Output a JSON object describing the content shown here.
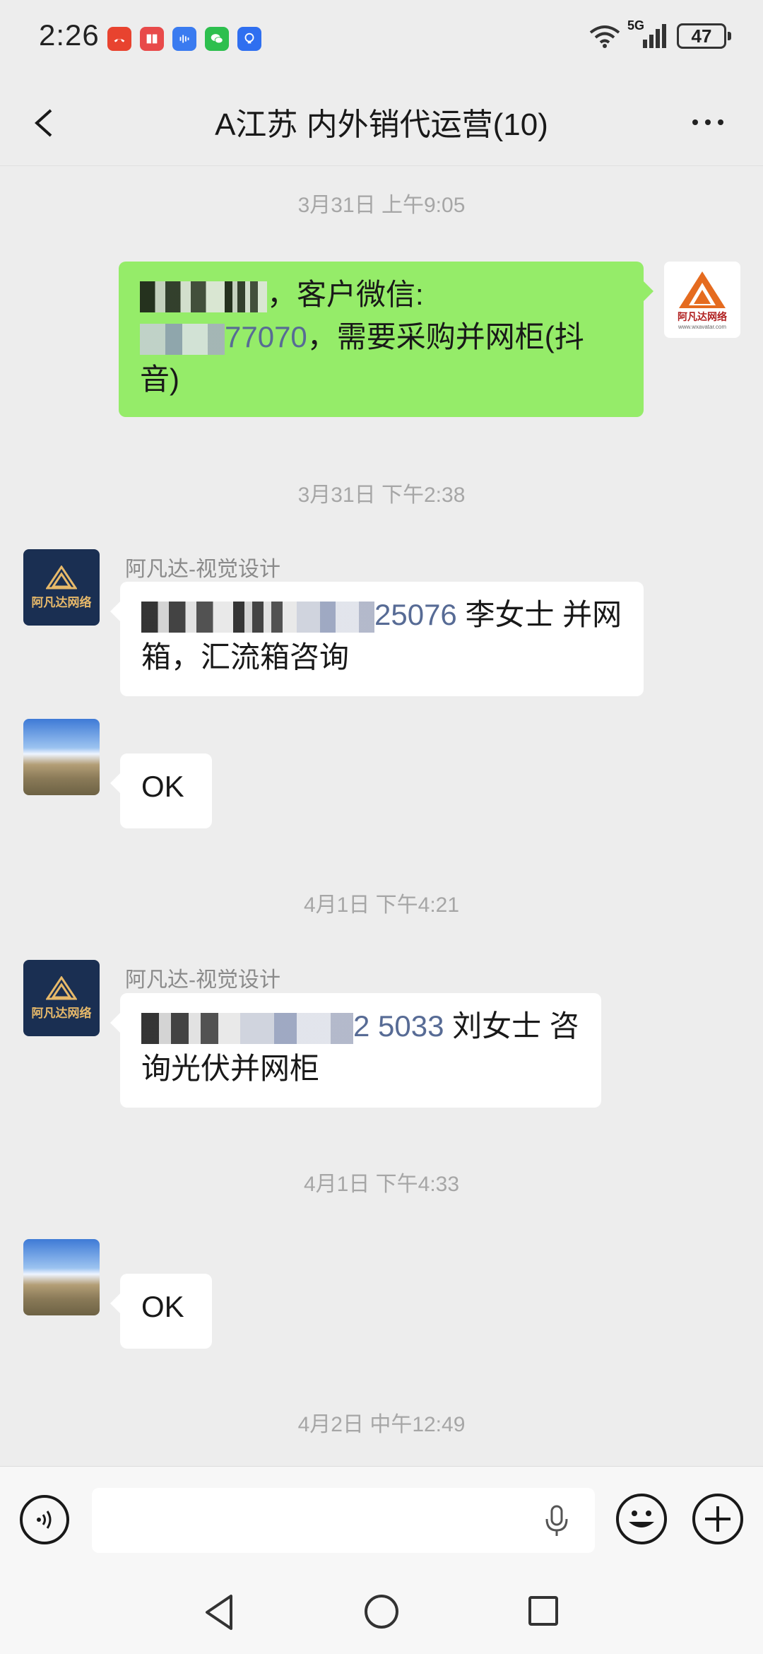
{
  "status_bar": {
    "time": "2:26",
    "network": "5G",
    "battery": "47"
  },
  "header": {
    "title": "A江苏  内外销代运营(10)"
  },
  "messages": {
    "ts1": "3月31日 上午9:05",
    "m1_text_a": "，客户微信:",
    "m1_link": "77070",
    "m1_text_b": "，需要采购并网柜(抖音)",
    "ts2": "3月31日 下午2:38",
    "m2_sender": "阿凡达-视觉设计",
    "m2_link": "25076",
    "m2_text": " 李女士  并网箱，汇流箱咨询",
    "m3_text": "OK",
    "ts3": "4月1日 下午4:21",
    "m4_sender": "阿凡达-视觉设计",
    "m4_link": "2 5033",
    "m4_text": " 刘女士      咨询光伏并网柜",
    "ts4": "4月1日 下午4:33",
    "m5_text": "OK",
    "ts5": "4月2日 中午12:49"
  },
  "avatars": {
    "brand_name": "阿凡达网络",
    "brand_url": "www.wxavatar.com"
  },
  "colors": {
    "background": "#ededed",
    "self_bubble": "#95ec69",
    "other_bubble": "#ffffff",
    "link": "#576b95"
  }
}
